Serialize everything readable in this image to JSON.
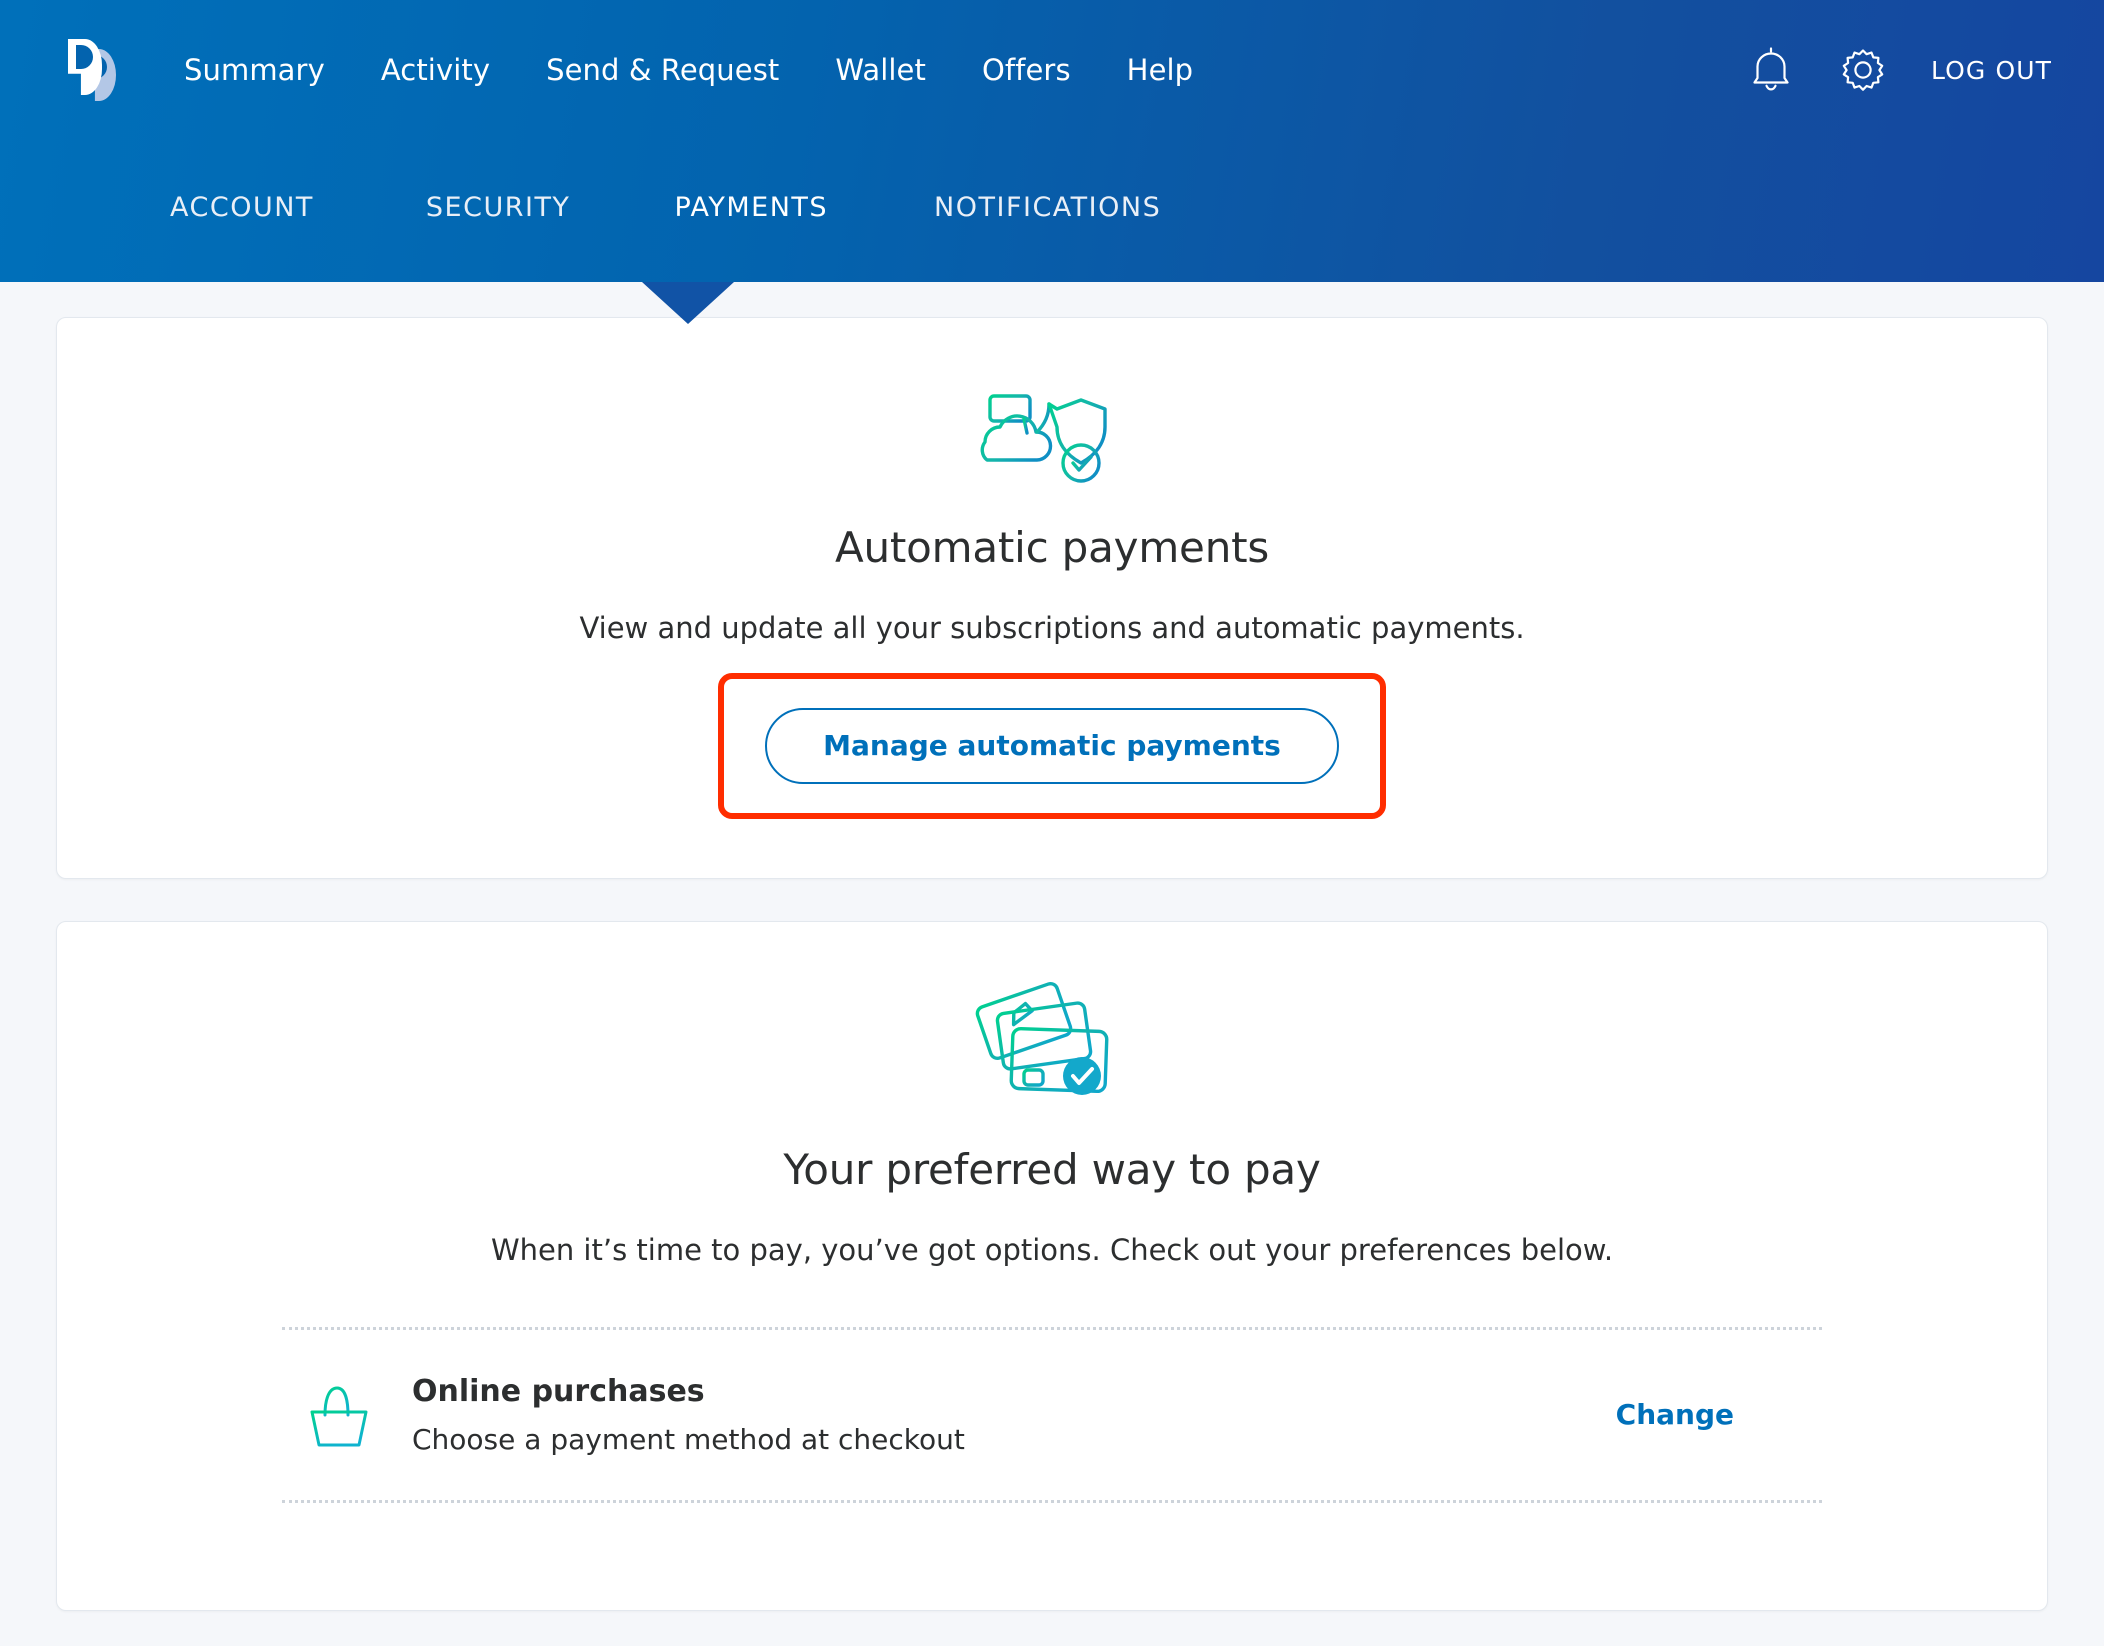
{
  "brand": {
    "logo_name": "paypal-logo"
  },
  "header": {
    "main_nav": [
      {
        "label": "Summary"
      },
      {
        "label": "Activity"
      },
      {
        "label": "Send & Request"
      },
      {
        "label": "Wallet"
      },
      {
        "label": "Offers"
      },
      {
        "label": "Help"
      }
    ],
    "notifications_icon": "bell-icon",
    "settings_icon": "gear-icon",
    "logout_label": "LOG OUT",
    "sub_nav": [
      {
        "label": "ACCOUNT",
        "active": false
      },
      {
        "label": "SECURITY",
        "active": false
      },
      {
        "label": "PAYMENTS",
        "active": true
      },
      {
        "label": "NOTIFICATIONS",
        "active": false
      }
    ]
  },
  "cards": {
    "automatic_payments": {
      "icon": "cloud-card-shield-check-icon",
      "title": "Automatic payments",
      "description": "View and update all your subscriptions and automatic payments.",
      "button_label": "Manage automatic payments",
      "highlight_color": "#ff2d00"
    },
    "preferred_way_to_pay": {
      "icon": "stacked-cards-check-icon",
      "title": "Your preferred way to pay",
      "description": "When it’s time to pay, you’ve got options. Check out your preferences below.",
      "rows": [
        {
          "icon": "shopping-basket-icon",
          "title": "Online purchases",
          "subtitle": "Choose a payment method at checkout",
          "action_label": "Change"
        }
      ]
    }
  },
  "colors": {
    "brand_blue": "#0070ba",
    "header_gradient_start": "#0070ba",
    "header_gradient_end": "#1546a0",
    "page_background": "#f5f7fa",
    "accent_teal": "#00cf92",
    "accent_cyan": "#0fa8c9",
    "annotation_red": "#ff2d00",
    "text_dark": "#2c2e2f"
  }
}
